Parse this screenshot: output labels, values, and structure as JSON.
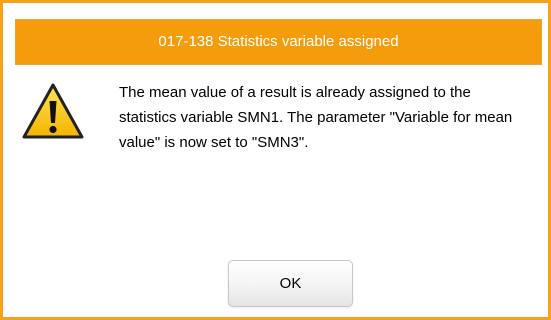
{
  "dialog": {
    "title": "017-138 Statistics variable assigned",
    "message": "The mean value of a result is already assigned to the statistics variable SMN1. The parameter \"Variable for mean value\" is now set to \"SMN3\".",
    "icon": "warning-icon",
    "ok_label": "OK"
  },
  "colors": {
    "accent": "#f59c0c",
    "border": "#f7a21b",
    "title_text": "#ffffff"
  }
}
